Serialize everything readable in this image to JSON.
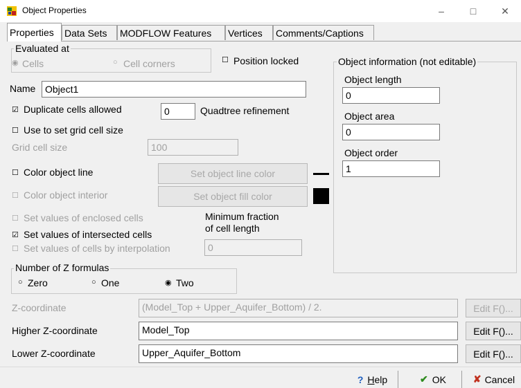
{
  "window": {
    "title": "Object Properties",
    "minimize_glyph": "–",
    "maximize_glyph": "□",
    "close_glyph": "✕"
  },
  "tabs": [
    "Properties",
    "Data Sets",
    "MODFLOW Features",
    "Vertices",
    "Comments/Captions"
  ],
  "evaluated_at": {
    "title": "Evaluated at",
    "option_cells": "Cells",
    "option_corners": "Cell corners"
  },
  "position_locked": "Position locked",
  "name": {
    "label": "Name",
    "value": "Object1"
  },
  "duplicate_cells": "Duplicate cells allowed",
  "quadtree": {
    "value": "0",
    "label": "Quadtree refinement"
  },
  "use_grid_cell_size": "Use to set grid cell size",
  "grid_cell_size": {
    "label": "Grid cell size",
    "value": "100"
  },
  "color_line": {
    "label": "Color object line",
    "button": "Set object line color",
    "swatch": "#000000"
  },
  "color_interior": {
    "label": "Color object interior",
    "button": "Set object fill color",
    "swatch": "#000000"
  },
  "set_enclosed": "Set values of enclosed cells",
  "set_intersected": "Set values of intersected cells",
  "set_interpolation": "Set values of cells by interpolation",
  "min_fraction": {
    "line1": "Minimum fraction",
    "line2": "of cell length",
    "value": "0"
  },
  "z_formulas": {
    "title": "Number of Z formulas",
    "zero": "Zero",
    "one": "One",
    "two": "Two"
  },
  "object_info": {
    "title": "Object information (not editable)",
    "length_label": "Object length",
    "length_value": "0",
    "area_label": "Object area",
    "area_value": "0",
    "order_label": "Object order",
    "order_value": "1"
  },
  "z_coordinate": {
    "label": "Z-coordinate",
    "value": "(Model_Top + Upper_Aquifer_Bottom) / 2.",
    "button": "Edit F()..."
  },
  "higher_z": {
    "label": "Higher Z-coordinate",
    "value": "Model_Top",
    "button": "Edit F()..."
  },
  "lower_z": {
    "label": "Lower Z-coordinate",
    "value": "Upper_Aquifer_Bottom",
    "button": "Edit F()..."
  },
  "buttons": {
    "help_mark": "?",
    "help_rest": "elp",
    "help_key": "H",
    "ok": "OK",
    "ok_icon": "✔",
    "cancel": "Cancel",
    "cancel_icon": "✘"
  }
}
